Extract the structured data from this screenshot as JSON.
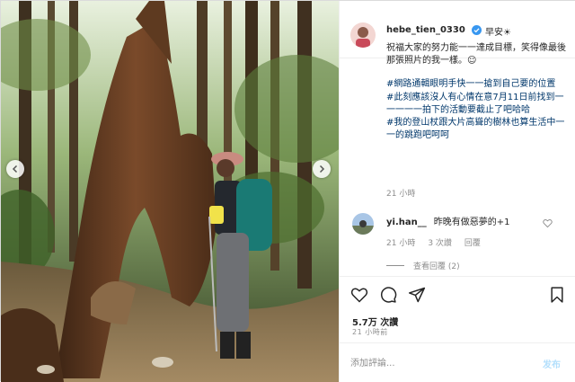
{
  "post": {
    "username": "hebe_tien_0330",
    "greeting": "早安☀",
    "caption_lines": [
      "祝福大家的努力能一一達成目標，笑得像最後那張照片的我一樣。☺"
    ],
    "hashtags": [
      "#網路通輯眼明手快一一搶到自己要的位置",
      "#此刻應該沒人有心情在意7月11日前找到一一一一一拍下的活動要截止了吧哈哈",
      "#我的登山杖跟大片高聳的樹林也算生活中一一的跳跑吧呵呵"
    ],
    "caption_time": "21 小時",
    "comment": {
      "username": "yi.han__",
      "text": "昨晚有做惡夢的+1",
      "time": "21 小時",
      "likes": "3 次讚",
      "reply": "回覆"
    },
    "view_replies": "查看回覆 (2)",
    "likes_count": "5.7万 次讚",
    "post_time": "21 小時前",
    "comment_placeholder": "添加評論...",
    "post_label": "发布"
  },
  "icons": {
    "verified": "verified-badge-icon",
    "like": "heart-icon",
    "comment": "comment-icon",
    "share": "share-icon",
    "save": "bookmark-icon",
    "prev": "chevron-left-icon",
    "next": "chevron-right-icon"
  },
  "colors": {
    "hashtag": "#00376b",
    "verified": "#3897f0",
    "post_button": "#b2dffc"
  }
}
